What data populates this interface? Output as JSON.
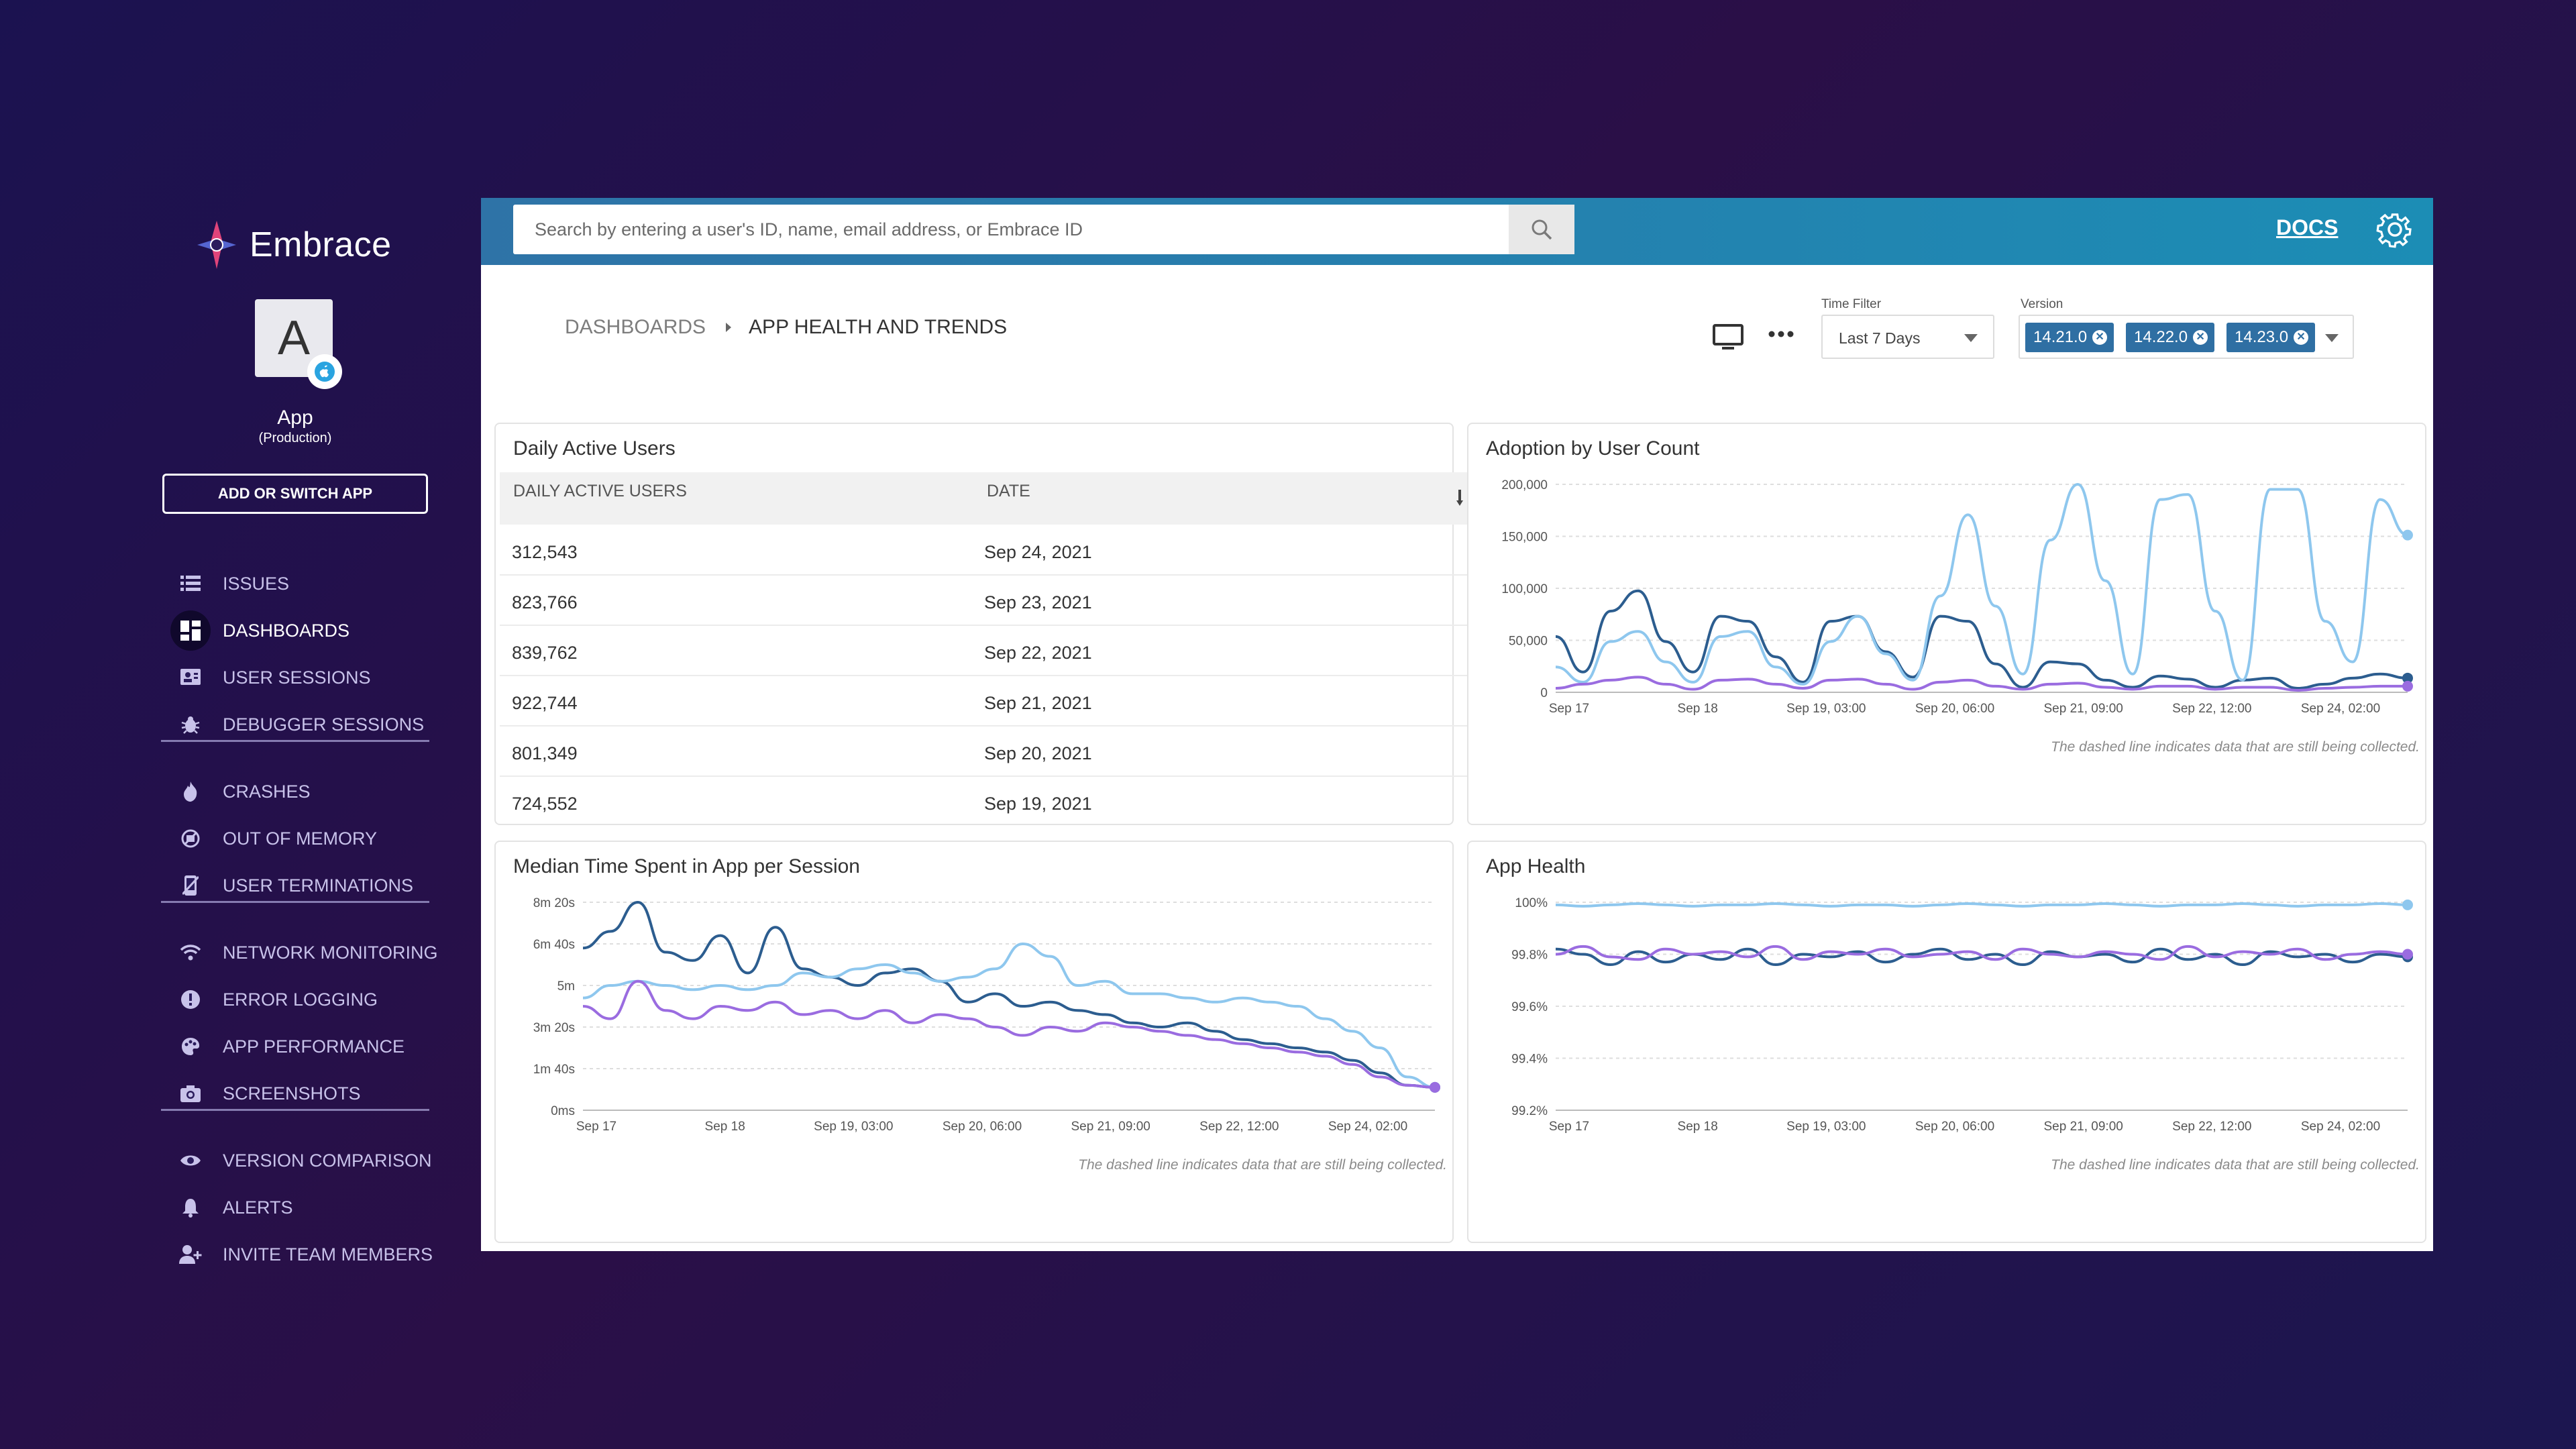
{
  "brand": {
    "name": "Embrace"
  },
  "app": {
    "initial": "A",
    "name": "App",
    "env": "(Production)",
    "switch_label": "ADD OR SWITCH APP"
  },
  "nav": {
    "issues": "ISSUES",
    "dashboards": "DASHBOARDS",
    "user_sessions": "USER SESSIONS",
    "debugger_sessions": "DEBUGGER SESSIONS",
    "crashes": "CRASHES",
    "out_of_memory": "OUT OF MEMORY",
    "user_terminations": "USER TERMINATIONS",
    "network_monitoring": "NETWORK MONITORING",
    "error_logging": "ERROR LOGGING",
    "app_performance": "APP PERFORMANCE",
    "screenshots": "SCREENSHOTS",
    "version_comparison": "VERSION COMPARISON",
    "alerts": "ALERTS",
    "invite_team": "INVITE TEAM MEMBERS"
  },
  "topbar": {
    "search_placeholder": "Search by entering a user's ID, name, email address, or Embrace ID",
    "docs_label": "DOCS"
  },
  "breadcrumb": {
    "root": "DASHBOARDS",
    "current": "APP HEALTH AND TRENDS"
  },
  "filters": {
    "time_label": "Time Filter",
    "time_value": "Last 7 Days",
    "version_label": "Version",
    "versions": [
      "14.21.0",
      "14.22.0",
      "14.23.0"
    ]
  },
  "colors": {
    "dark_blue": "#2c5d8f",
    "light_blue": "#8ec7ee",
    "purple": "#9a6ce0",
    "accent": "#2f6fa3"
  },
  "dau_card": {
    "title": "Daily Active Users",
    "col_users": "DAILY ACTIVE USERS",
    "col_date": "DATE",
    "rows": [
      {
        "users": "312,543",
        "date": "Sep 24, 2021"
      },
      {
        "users": "823,766",
        "date": "Sep 23, 2021"
      },
      {
        "users": "839,762",
        "date": "Sep 22, 2021"
      },
      {
        "users": "922,744",
        "date": "Sep 21, 2021"
      },
      {
        "users": "801,349",
        "date": "Sep 20, 2021"
      },
      {
        "users": "724,552",
        "date": "Sep 19, 2021"
      }
    ]
  },
  "chart_data": [
    {
      "type": "line",
      "title": "Adoption by User Count",
      "x_tick_labels": [
        "Sep 17",
        "Sep 18",
        "Sep 19, 03:00",
        "Sep 20, 06:00",
        "Sep 21, 09:00",
        "Sep 22, 12:00",
        "Sep 24, 02:00"
      ],
      "y_tick_labels": [
        "200,000",
        "150,000",
        "100,000",
        "50,000",
        "0"
      ],
      "ylim": [
        0,
        205000
      ],
      "x": [
        0,
        6,
        12,
        18,
        24,
        30,
        36,
        42,
        48,
        54,
        60,
        66,
        72,
        78,
        84,
        90,
        96,
        102,
        108,
        114,
        120,
        126,
        132,
        138,
        144,
        150,
        156,
        162,
        168,
        174,
        180,
        186
      ],
      "series": [
        {
          "color": "#2c5d8f",
          "values": [
            55000,
            20000,
            80000,
            100000,
            50000,
            20000,
            75000,
            70000,
            35000,
            10000,
            70000,
            75000,
            40000,
            15000,
            75000,
            70000,
            28000,
            5000,
            30000,
            28000,
            12000,
            5000,
            16000,
            13000,
            5000,
            12000,
            14000,
            4000,
            8000,
            14000,
            18000,
            14000
          ]
        },
        {
          "color": "#8ec7ee",
          "values": [
            25000,
            10000,
            50000,
            60000,
            30000,
            10000,
            55000,
            60000,
            25000,
            8000,
            50000,
            75000,
            38000,
            12000,
            95000,
            175000,
            85000,
            18000,
            150000,
            205000,
            110000,
            18000,
            190000,
            195000,
            80000,
            12000,
            200000,
            200000,
            70000,
            30000,
            190000,
            155000
          ]
        },
        {
          "color": "#9a6ce0",
          "values": [
            4000,
            8000,
            12000,
            15000,
            8000,
            3000,
            12000,
            13000,
            8000,
            4000,
            12000,
            13000,
            8000,
            3000,
            10000,
            12000,
            6000,
            3000,
            8000,
            9000,
            5000,
            3000,
            6000,
            6000,
            3000,
            5000,
            5000,
            2000,
            4000,
            5000,
            6000,
            6000
          ]
        }
      ]
    },
    {
      "type": "line",
      "title": "Median Time Spent in App per Session",
      "x_tick_labels": [
        "Sep 17",
        "Sep 18",
        "Sep 19, 03:00",
        "Sep 20, 06:00",
        "Sep 21, 09:00",
        "Sep 22, 12:00",
        "Sep 24, 02:00"
      ],
      "y_tick_labels": [
        "8m 20s",
        "6m 40s",
        "5m",
        "3m 20s",
        "1m 40s",
        "0ms"
      ],
      "ylim": [
        0,
        500
      ],
      "x": [
        0,
        6,
        12,
        18,
        24,
        30,
        36,
        42,
        48,
        54,
        60,
        66,
        72,
        78,
        84,
        90,
        96,
        102,
        108,
        114,
        120,
        126,
        132,
        138,
        144,
        150,
        156,
        162,
        168,
        174,
        180,
        186
      ],
      "series": [
        {
          "color": "#2c5d8f",
          "values": [
            390,
            430,
            500,
            380,
            360,
            420,
            330,
            440,
            340,
            320,
            300,
            330,
            340,
            310,
            260,
            280,
            250,
            260,
            240,
            230,
            210,
            200,
            210,
            190,
            170,
            160,
            150,
            140,
            120,
            90,
            60,
            55
          ]
        },
        {
          "color": "#8ec7ee",
          "values": [
            270,
            300,
            310,
            300,
            290,
            300,
            290,
            300,
            330,
            320,
            340,
            350,
            330,
            310,
            320,
            340,
            400,
            370,
            300,
            310,
            280,
            280,
            270,
            260,
            270,
            260,
            250,
            220,
            190,
            150,
            80,
            55
          ]
        },
        {
          "color": "#9a6ce0",
          "values": [
            250,
            220,
            310,
            240,
            220,
            250,
            240,
            260,
            230,
            240,
            220,
            240,
            210,
            230,
            220,
            200,
            180,
            200,
            190,
            210,
            200,
            190,
            180,
            170,
            160,
            150,
            140,
            130,
            110,
            80,
            60,
            55
          ]
        }
      ]
    },
    {
      "type": "line",
      "title": "App Health",
      "x_tick_labels": [
        "Sep 17",
        "Sep 18",
        "Sep 19, 03:00",
        "Sep 20, 06:00",
        "Sep 21, 09:00",
        "Sep 22, 12:00",
        "Sep 24, 02:00"
      ],
      "y_tick_labels": [
        "100%",
        "99.8%",
        "99.6%",
        "99.4%",
        "99.2%"
      ],
      "ylim": [
        99.2,
        100
      ],
      "x": [
        0,
        6,
        12,
        18,
        24,
        30,
        36,
        42,
        48,
        54,
        60,
        66,
        72,
        78,
        84,
        90,
        96,
        102,
        108,
        114,
        120,
        126,
        132,
        138,
        144,
        150,
        156,
        162,
        168,
        174,
        180,
        186
      ],
      "series": [
        {
          "color": "#8ec7ee",
          "values": [
            99.99,
            99.985,
            99.99,
            99.995,
            99.99,
            99.985,
            99.99,
            99.99,
            99.995,
            99.99,
            99.985,
            99.99,
            99.99,
            99.985,
            99.99,
            99.995,
            99.99,
            99.985,
            99.99,
            99.99,
            99.995,
            99.99,
            99.985,
            99.99,
            99.99,
            99.995,
            99.99,
            99.985,
            99.99,
            99.99,
            99.995,
            99.99
          ]
        },
        {
          "color": "#2c5d8f",
          "values": [
            99.82,
            99.8,
            99.76,
            99.81,
            99.77,
            99.8,
            99.78,
            99.82,
            99.76,
            99.8,
            99.79,
            99.81,
            99.77,
            99.8,
            99.82,
            99.78,
            99.8,
            99.76,
            99.81,
            99.79,
            99.8,
            99.77,
            99.82,
            99.78,
            99.8,
            99.76,
            99.81,
            99.79,
            99.8,
            99.77,
            99.8,
            99.79
          ]
        },
        {
          "color": "#9a6ce0",
          "values": [
            99.8,
            99.83,
            99.79,
            99.78,
            99.82,
            99.8,
            99.81,
            99.79,
            99.83,
            99.78,
            99.81,
            99.8,
            99.82,
            99.79,
            99.8,
            99.81,
            99.78,
            99.82,
            99.8,
            99.79,
            99.81,
            99.8,
            99.78,
            99.83,
            99.79,
            99.81,
            99.8,
            99.82,
            99.78,
            99.8,
            99.81,
            99.8
          ]
        }
      ]
    }
  ],
  "chart_note": "The dashed line indicates data that are still being collected."
}
